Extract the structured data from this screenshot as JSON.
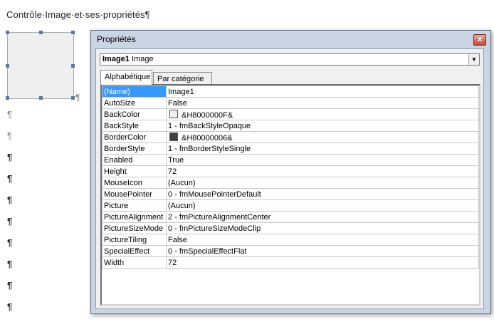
{
  "document": {
    "title": "Contrôle·Image·et·ses·propriétés¶",
    "pilcrow": "¶"
  },
  "properties_window": {
    "title": "Propriétés",
    "close_label": "x",
    "object_selector": {
      "name": "Image1",
      "type": "Image"
    },
    "tabs": [
      "Alphabétique",
      "Par catégorie"
    ],
    "selected_tab": "Alphabétique",
    "rows": [
      {
        "name": "(Name)",
        "value": "Image1",
        "selected": true
      },
      {
        "name": "AutoSize",
        "value": "False"
      },
      {
        "name": "BackColor",
        "value": "&H8000000F&",
        "swatch": "#f0f0f0"
      },
      {
        "name": "BackStyle",
        "value": "1 - fmBackStyleOpaque"
      },
      {
        "name": "BorderColor",
        "value": "&H80000006&",
        "swatch": "#404040"
      },
      {
        "name": "BorderStyle",
        "value": "1 - fmBorderStyleSingle"
      },
      {
        "name": "Enabled",
        "value": "True"
      },
      {
        "name": "Height",
        "value": "72"
      },
      {
        "name": "MouseIcon",
        "value": "(Aucun)"
      },
      {
        "name": "MousePointer",
        "value": "0 - fmMousePointerDefault"
      },
      {
        "name": "Picture",
        "value": "(Aucun)"
      },
      {
        "name": "PictureAlignment",
        "value": "2 - fmPictureAlignmentCenter"
      },
      {
        "name": "PictureSizeMode",
        "value": "0 - fmPictureSizeModeClip"
      },
      {
        "name": "PictureTiling",
        "value": "False"
      },
      {
        "name": "SpecialEffect",
        "value": "0 - fmSpecialEffectFlat"
      },
      {
        "name": "Width",
        "value": "72"
      }
    ]
  },
  "colors": {
    "selection": "#3399ff",
    "window_frame": "#c9d4e4"
  }
}
